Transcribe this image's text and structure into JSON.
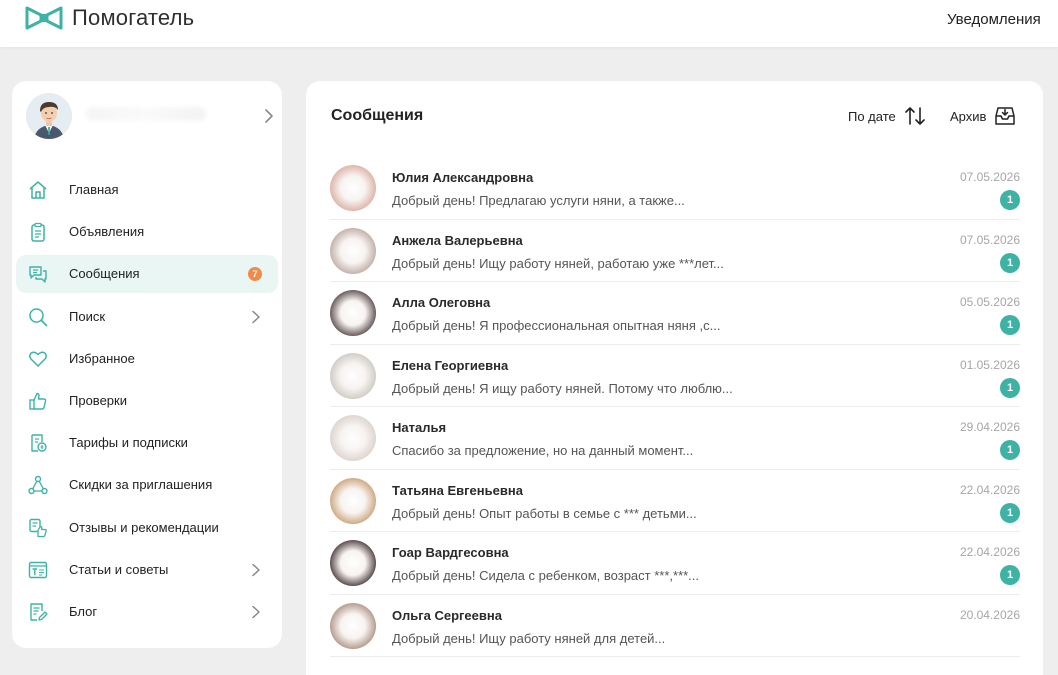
{
  "header": {
    "logo_text": "Помогатель",
    "notifications_label": "Уведомления",
    "brand_color": "#3fb2a6"
  },
  "sidebar": {
    "profile_icon": "user-avatar",
    "items": [
      {
        "label": "Главная",
        "icon": "home-icon"
      },
      {
        "label": "Объявления",
        "icon": "clipboard-icon"
      },
      {
        "label": "Сообщения",
        "icon": "chat-icon",
        "badge": "7",
        "active": true
      },
      {
        "label": "Поиск",
        "icon": "search-icon",
        "has_submenu": true
      },
      {
        "label": "Избранное",
        "icon": "heart-icon"
      },
      {
        "label": "Проверки",
        "icon": "thumbs-up-icon"
      },
      {
        "label": "Тарифы и подписки",
        "icon": "receipt-icon"
      },
      {
        "label": "Скидки за приглашения",
        "icon": "network-icon"
      },
      {
        "label": "Отзывы и рекомендации",
        "icon": "reviews-icon"
      },
      {
        "label": "Статьи и советы",
        "icon": "article-icon",
        "has_submenu": true
      },
      {
        "label": "Блог",
        "icon": "blog-icon",
        "has_submenu": true
      }
    ]
  },
  "main": {
    "title": "Сообщения",
    "sort_label": "По дате",
    "archive_label": "Архив",
    "messages": [
      {
        "name": "Юлия Александровна",
        "text": "Добрый день! Предлагаю услуги няни, а также...",
        "date": "07.05.2026",
        "count": "1",
        "avatar_tone": "#d9a89a"
      },
      {
        "name": "Анжела Валерьевна",
        "text": "Добрый день! Ищу работу няней, работаю уже ***лет...",
        "date": "07.05.2026",
        "count": "1",
        "avatar_tone": "#b8a49c"
      },
      {
        "name": "Алла Олеговна",
        "text": "Добрый день! Я профессиональная опытная няня ,с...",
        "date": "05.05.2026",
        "count": "1",
        "avatar_tone": "#4a3c3c"
      },
      {
        "name": "Елена Георгиевна",
        "text": "Добрый день! Я ищу работу няней. Потому что люблю...",
        "date": "01.05.2026",
        "count": "1",
        "avatar_tone": "#c9c4bd"
      },
      {
        "name": "Наталья",
        "text": "Спасибо за предложение, но на данный момент...",
        "date": "29.04.2026",
        "count": "1",
        "avatar_tone": "#d8cfc8"
      },
      {
        "name": "Татьяна Евгеньевна",
        "text": "Добрый день! Опыт работы в семье с *** детьми...",
        "date": "22.04.2026",
        "count": "1",
        "avatar_tone": "#c79a6c"
      },
      {
        "name": "Гоар Вардгесовна",
        "text": "Добрый день! Сидела с ребенком, возраст ***,***...",
        "date": "22.04.2026",
        "count": "1",
        "avatar_tone": "#3a2a2a"
      },
      {
        "name": "Ольга Сергеевна",
        "text": "Добрый день! Ищу работу няней для детей...",
        "date": "20.04.2026",
        "count": "",
        "avatar_tone": "#a88a7a"
      }
    ]
  }
}
